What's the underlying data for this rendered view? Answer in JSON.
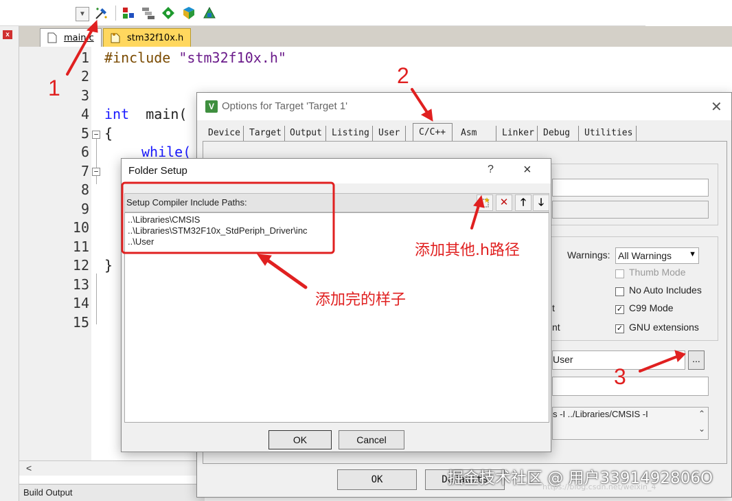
{
  "editor": {
    "tabs": [
      {
        "label": "main.c"
      },
      {
        "label": "stm32f10x.h"
      }
    ],
    "line_numbers": [
      "1",
      "2",
      "3",
      "4",
      "5",
      "6",
      "7",
      "8",
      "9",
      "10",
      "11",
      "12",
      "13",
      "14",
      "15"
    ],
    "code": {
      "l1_directive": "#include",
      "l1_string": "\"stm32f10x.h\"",
      "l4_type": "int",
      "l4_rest": "main(",
      "l5": "{",
      "l6_kw": "while(",
      "l12": "}"
    },
    "build_output_label": "Build Output"
  },
  "options_dialog": {
    "title": "Options for Target 'Target 1'",
    "icon_letter": "V",
    "tabs": [
      "Device",
      "Target",
      "Output",
      "Listing",
      "User",
      "C/C++",
      "Asm",
      "Linker",
      "Debug",
      "Utilities"
    ],
    "active_tab": "C/C++",
    "warnings_label": "Warnings:",
    "warnings_value": "All Warnings",
    "checkboxes": [
      {
        "label": "Thumb Mode",
        "checked": false,
        "enabled": false
      },
      {
        "label": "No Auto Includes",
        "checked": false,
        "enabled": true
      },
      {
        "label": "C99 Mode",
        "checked": true,
        "enabled": true
      },
      {
        "label": "GNU extensions",
        "checked": true,
        "enabled": true
      }
    ],
    "partial_label_1": "t",
    "partial_label_2": "nt",
    "include_paths_value": "User",
    "browse_button": "...",
    "misc_controls_text": "s -I ../Libraries/CMSIS -I",
    "ok_label": "OK",
    "defaults_label": "Defaults"
  },
  "folder_setup": {
    "title": "Folder Setup",
    "help": "?",
    "close": "×",
    "header_label": "Setup Compiler Include Paths:",
    "paths": [
      "..\\Libraries\\CMSIS",
      "..\\Libraries\\STM32F10x_StdPeriph_Driver\\inc",
      "..\\User"
    ],
    "ok_label": "OK",
    "cancel_label": "Cancel"
  },
  "annotations": {
    "n1": "1",
    "n2": "2",
    "n3": "3",
    "add_other_h_path": "添加其他.h路径",
    "after_adding": "添加完的样子",
    "watermark": "掘金技术社区 @ 用户3391492806O",
    "watermark_url": "https://blog.csdn.net/weixin_4"
  },
  "colors": {
    "annotation_red": "#e02020",
    "tab_active_yellow": "#ffd75e",
    "keyword_blue": "#1a1aff"
  }
}
